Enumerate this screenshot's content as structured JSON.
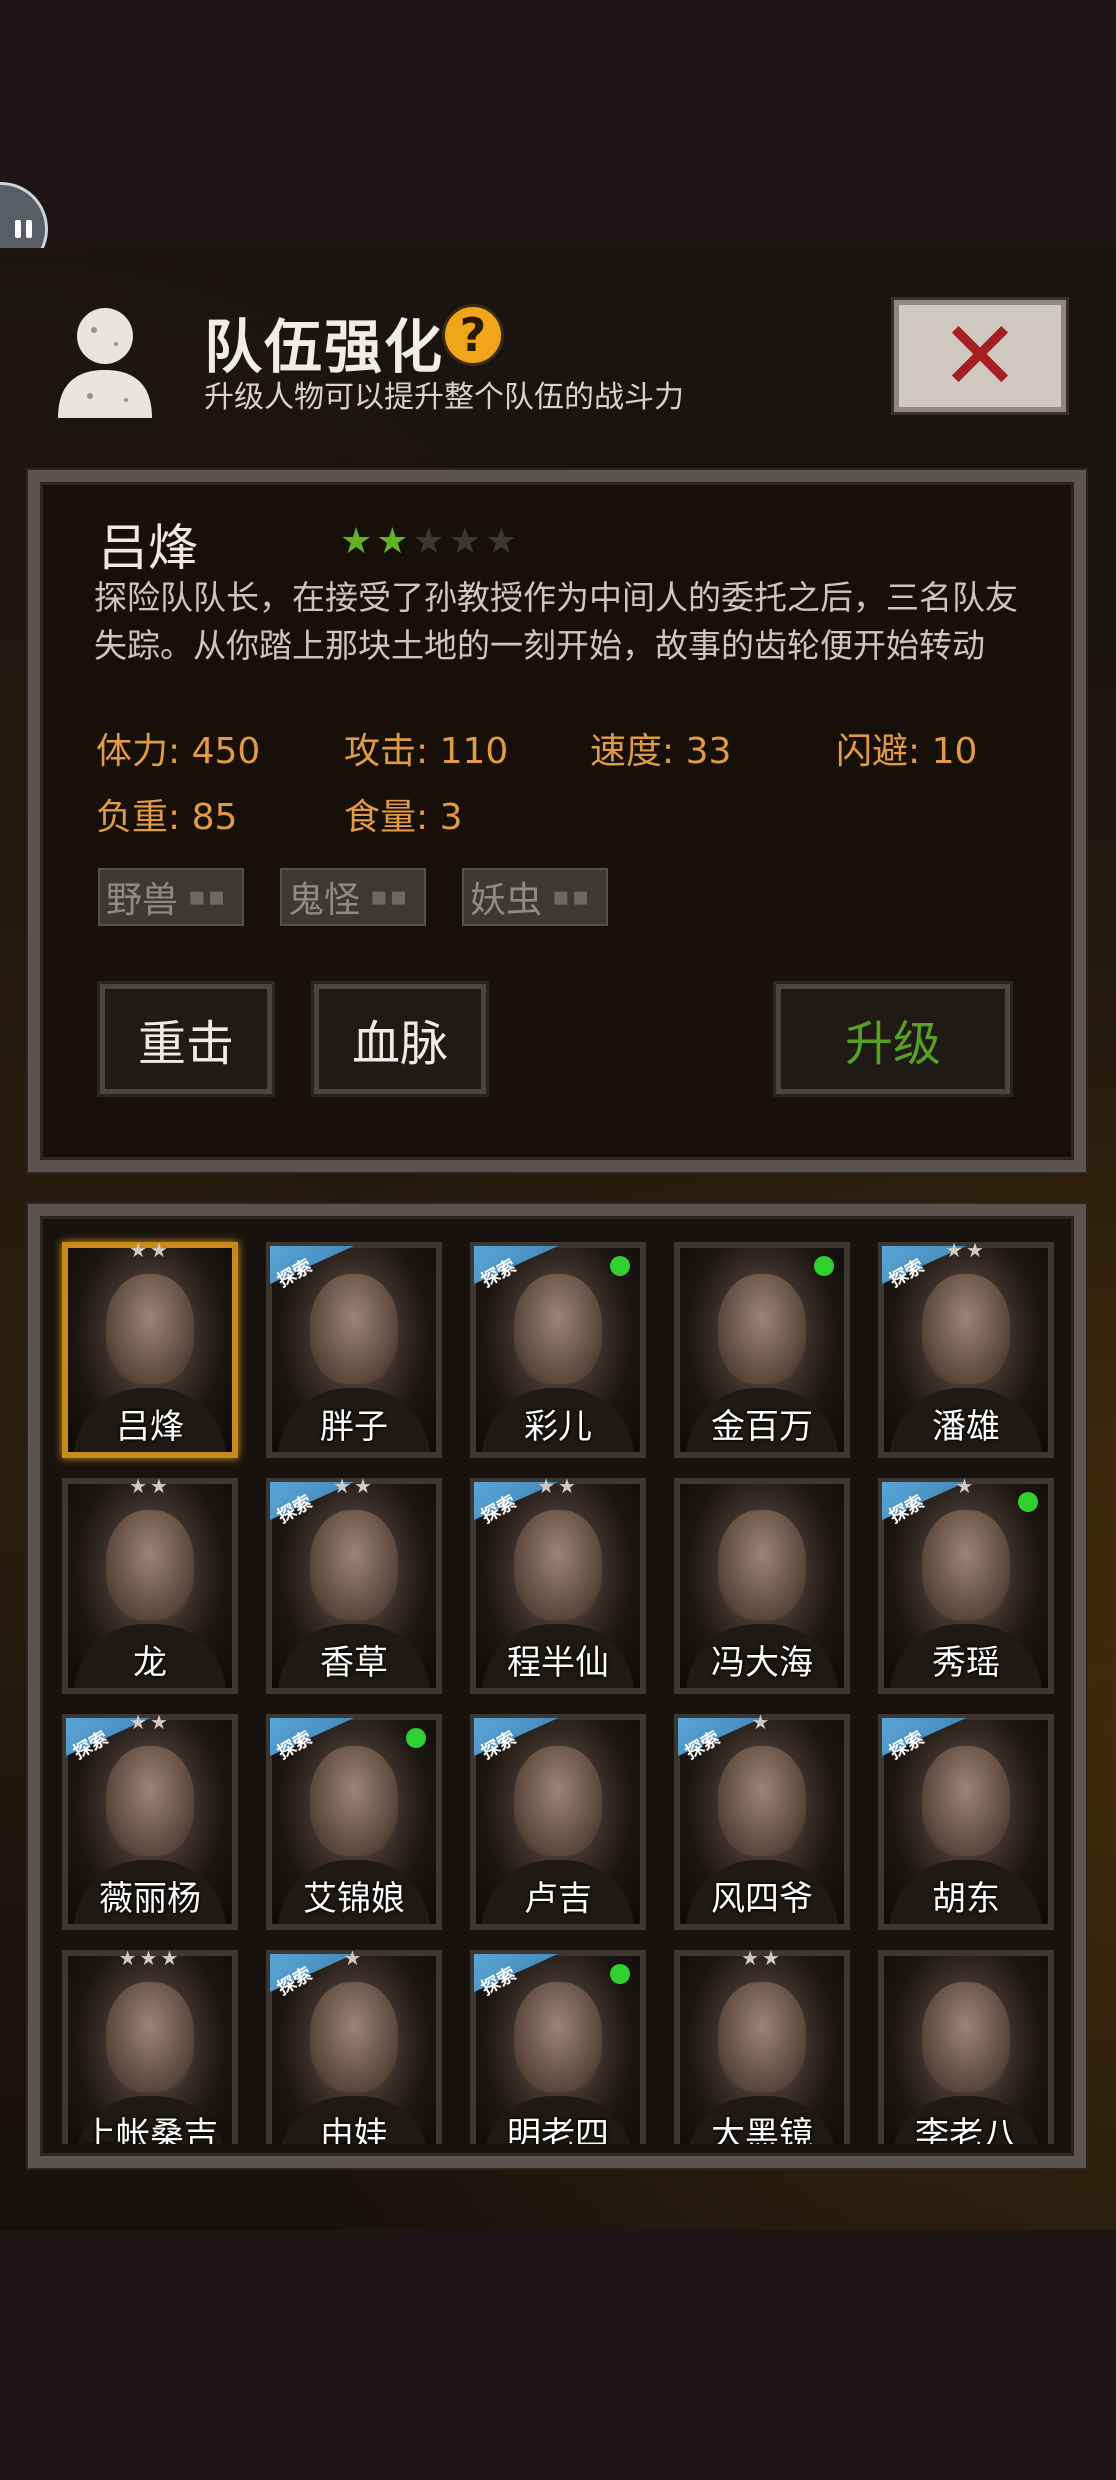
{
  "header": {
    "title": "队伍强化",
    "subtitle": "升级人物可以提升整个队伍的战斗力"
  },
  "selected": {
    "name": "吕烽",
    "stars_on": 2,
    "stars_total": 5,
    "description": "探险队队长，在接受了孙教授作为中间人的委托之后，三名队友失踪。从你踏上那块土地的一刻开始，故事的齿轮便开始转动",
    "stats": {
      "hp": "体力: 450",
      "atk": "攻击: 110",
      "spd": "速度: 33",
      "dodge": "闪避: 10",
      "load": "负重: 85",
      "food": "食量: 3"
    },
    "tags": [
      "野兽",
      "鬼怪",
      "妖虫"
    ],
    "tag_suffix": "▪▪",
    "skills": [
      "重击",
      "血脉"
    ],
    "upgrade_label": "升级"
  },
  "colors": {
    "accent_orange": "#e39a45",
    "star_green": "#63b222",
    "upgrade_green": "#58a023",
    "close_red": "#a41e22",
    "badge_blue": "#3b7fb0",
    "online_dot": "#2fd02f"
  },
  "icons": {
    "avatar": "user-silhouette-icon",
    "help": "question-icon",
    "close": "close-icon",
    "float": "pause-float-icon"
  },
  "help_glyph": "?",
  "close_glyph": "✕",
  "badge_label": "探索",
  "characters": [
    {
      "name": "吕烽",
      "stars": "★★",
      "explore": false,
      "dot": false,
      "selected": true
    },
    {
      "name": "胖子",
      "stars": "",
      "explore": true,
      "dot": false,
      "selected": false
    },
    {
      "name": "彩儿",
      "stars": "",
      "explore": true,
      "dot": true,
      "selected": false
    },
    {
      "name": "金百万",
      "stars": "",
      "explore": false,
      "dot": true,
      "selected": false
    },
    {
      "name": "潘雄",
      "stars": "★★",
      "explore": true,
      "dot": false,
      "selected": false
    },
    {
      "name": "龙",
      "stars": "★★",
      "explore": false,
      "dot": false,
      "selected": false
    },
    {
      "name": "香草",
      "stars": "★★",
      "explore": true,
      "dot": false,
      "selected": false
    },
    {
      "name": "程半仙",
      "stars": "★★",
      "explore": true,
      "dot": false,
      "selected": false
    },
    {
      "name": "冯大海",
      "stars": "",
      "explore": false,
      "dot": false,
      "selected": false
    },
    {
      "name": "秀瑶",
      "stars": "★",
      "explore": true,
      "dot": true,
      "selected": false
    },
    {
      "name": "薇丽杨",
      "stars": "★★",
      "explore": true,
      "dot": false,
      "selected": false
    },
    {
      "name": "艾锦娘",
      "stars": "",
      "explore": true,
      "dot": true,
      "selected": false
    },
    {
      "name": "卢吉",
      "stars": "",
      "explore": true,
      "dot": false,
      "selected": false
    },
    {
      "name": "风四爷",
      "stars": "★",
      "explore": true,
      "dot": false,
      "selected": false
    },
    {
      "name": "胡东",
      "stars": "",
      "explore": true,
      "dot": false,
      "selected": false
    },
    {
      "name": "上帐桑吉",
      "stars": "★★★",
      "explore": false,
      "dot": false,
      "selected": false
    },
    {
      "name": "由娃",
      "stars": "★",
      "explore": true,
      "dot": false,
      "selected": false
    },
    {
      "name": "明老四",
      "stars": "",
      "explore": true,
      "dot": true,
      "selected": false
    },
    {
      "name": "大黑镜",
      "stars": "★★",
      "explore": false,
      "dot": false,
      "selected": false
    },
    {
      "name": "李老八",
      "stars": "",
      "explore": false,
      "dot": false,
      "selected": false
    }
  ]
}
